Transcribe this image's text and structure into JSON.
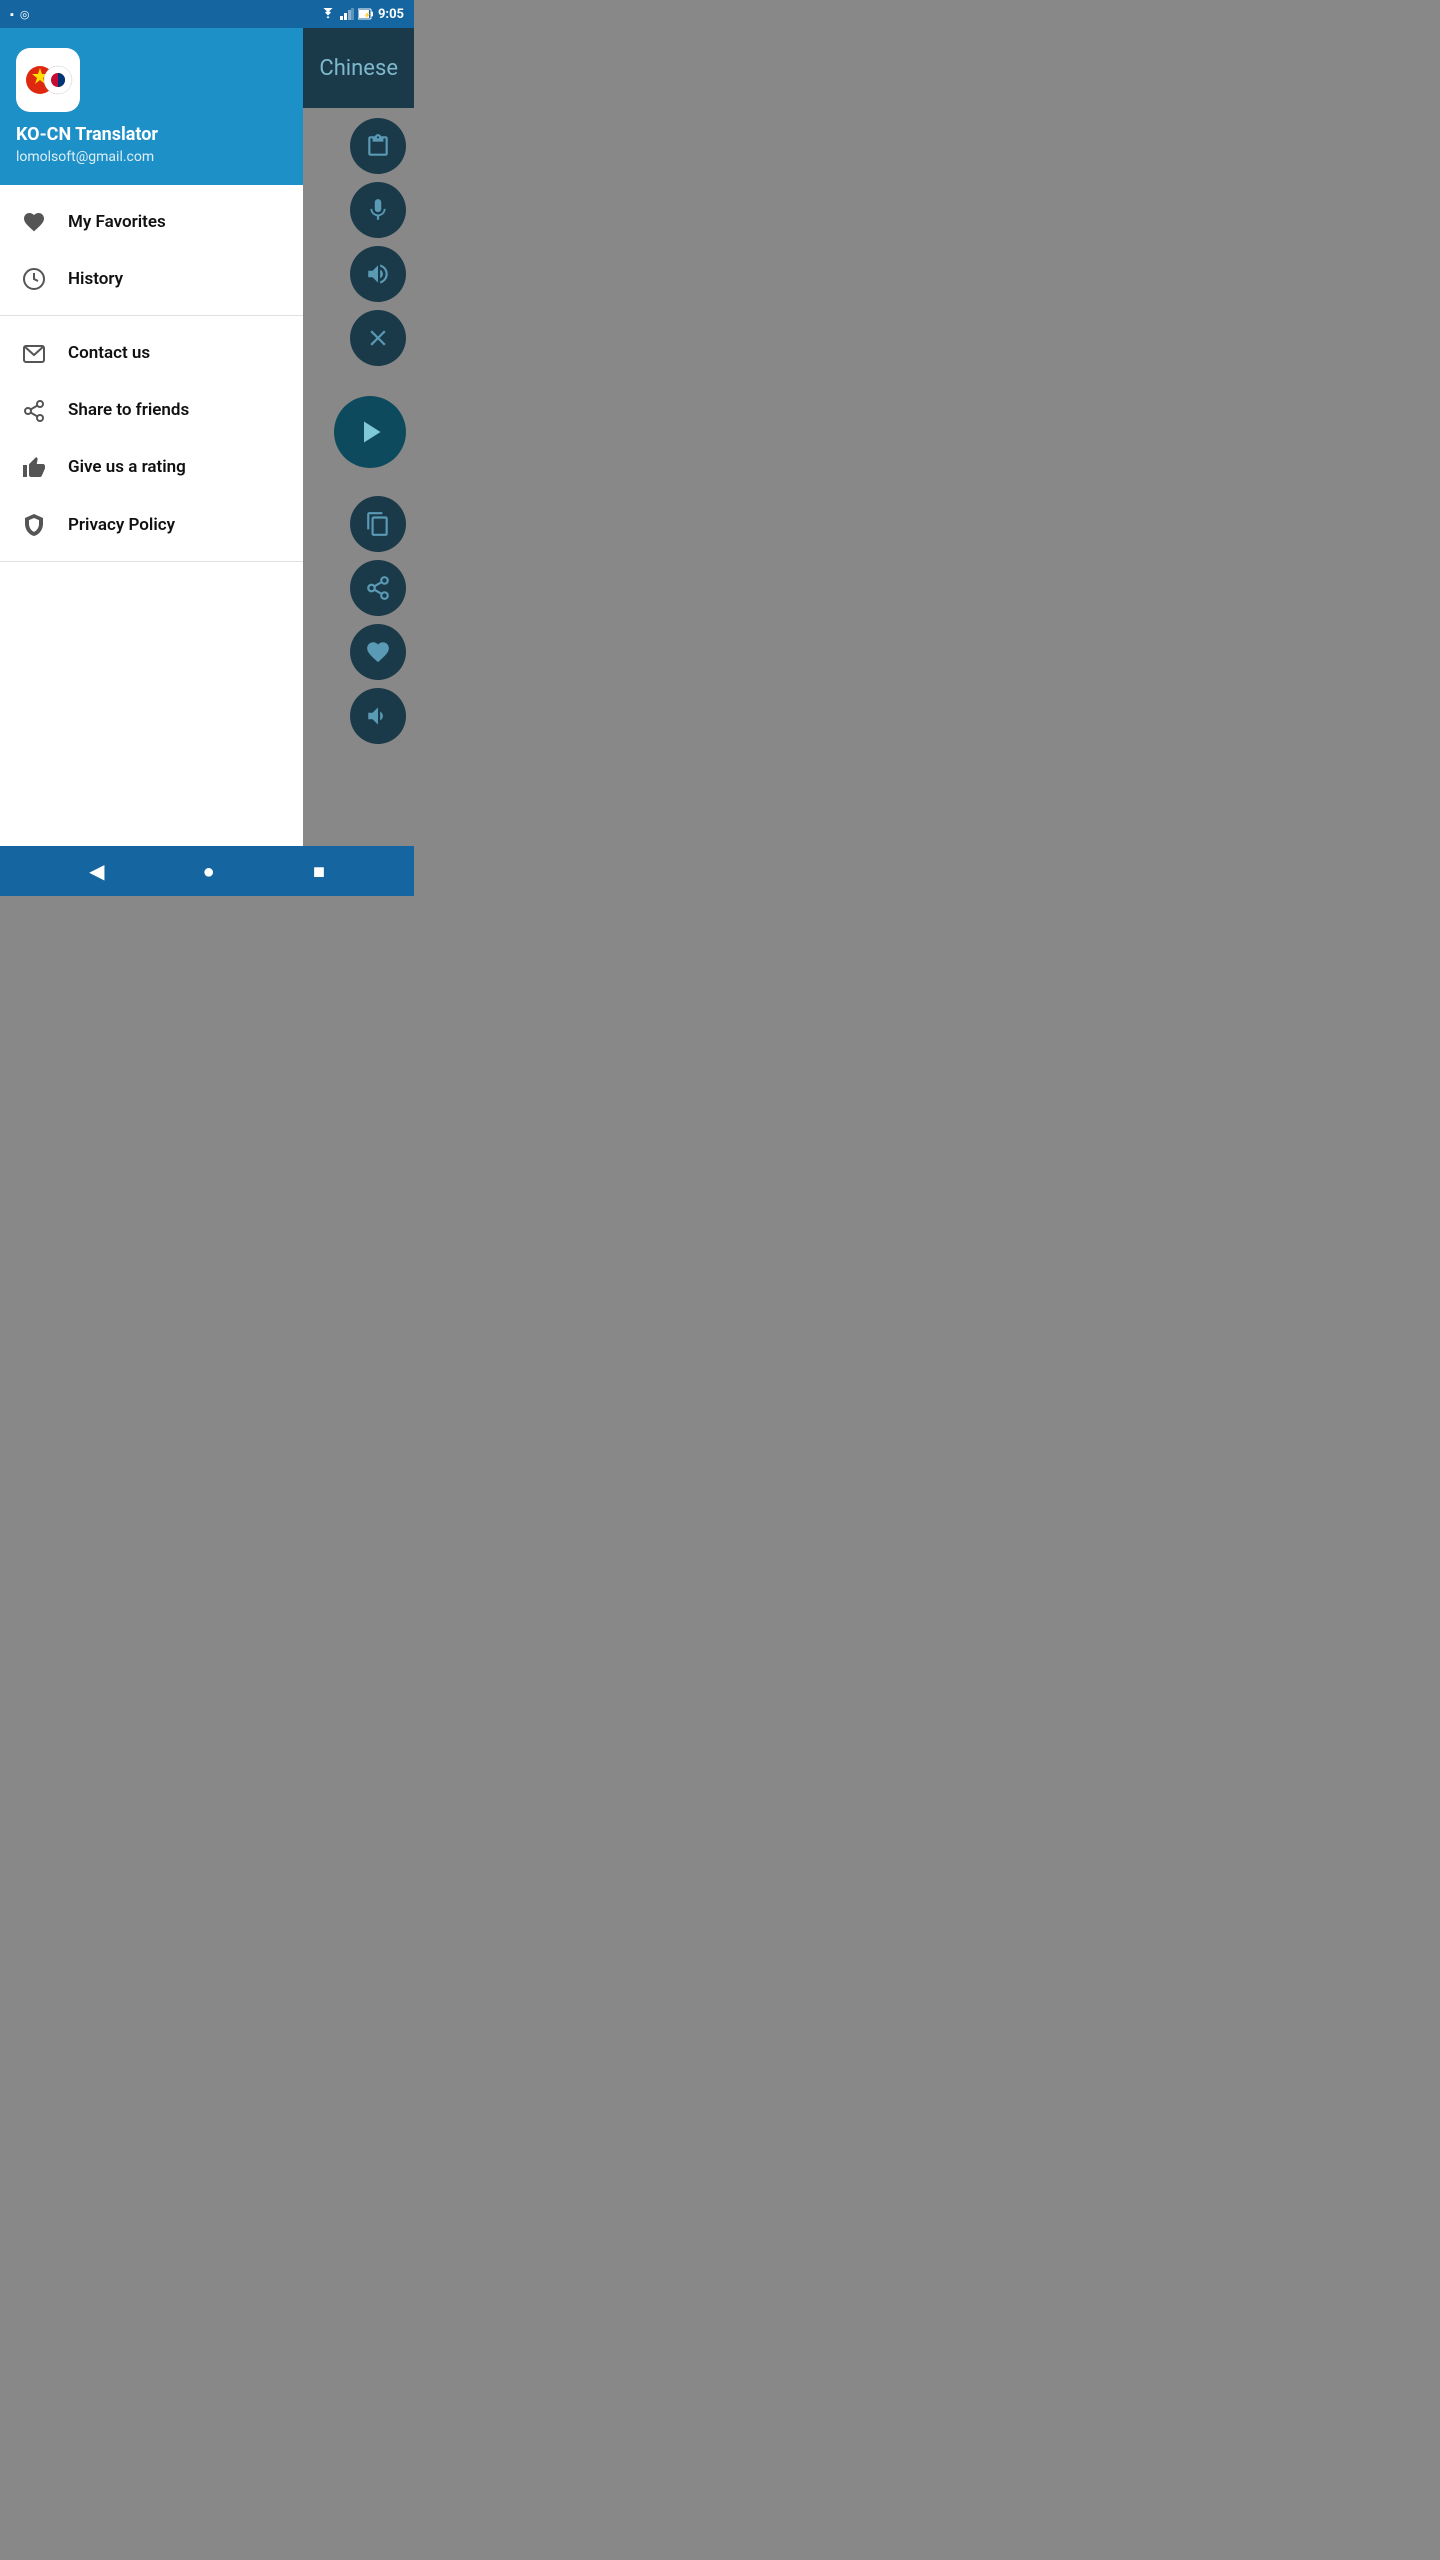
{
  "statusBar": {
    "time": "9:05",
    "leftIcons": [
      "sd-card-icon",
      "circle-icon"
    ],
    "rightIcons": [
      "wifi-icon",
      "signal-icon",
      "battery-icon"
    ]
  },
  "appHeader": {
    "appName": "KO-CN Translator",
    "email": "lomolsoft@gmail.com",
    "iconEmoji": "🇨🇳🇰🇷"
  },
  "drawer": {
    "sections": [
      {
        "items": [
          {
            "label": "My Favorites",
            "icon": "heart-icon"
          },
          {
            "label": "History",
            "icon": "clock-icon"
          }
        ]
      },
      {
        "items": [
          {
            "label": "Contact us",
            "icon": "mail-icon"
          },
          {
            "label": "Share to friends",
            "icon": "share-icon"
          },
          {
            "label": "Give us a rating",
            "icon": "thumbsup-icon"
          },
          {
            "label": "Privacy Policy",
            "icon": "shield-icon"
          }
        ]
      }
    ]
  },
  "appPanel": {
    "languageLabel": "Chinese",
    "buttons": [
      {
        "icon": "clipboard-icon"
      },
      {
        "icon": "mic-icon"
      },
      {
        "icon": "volume-icon"
      },
      {
        "icon": "close-icon"
      }
    ],
    "playButton": {
      "icon": "play-icon"
    },
    "bottomButtons": [
      {
        "icon": "copy-icon"
      },
      {
        "icon": "share2-icon"
      },
      {
        "icon": "heart2-icon"
      },
      {
        "icon": "volume2-icon"
      }
    ]
  },
  "bottomNav": {
    "back": "◀",
    "home": "●",
    "recent": "■"
  }
}
